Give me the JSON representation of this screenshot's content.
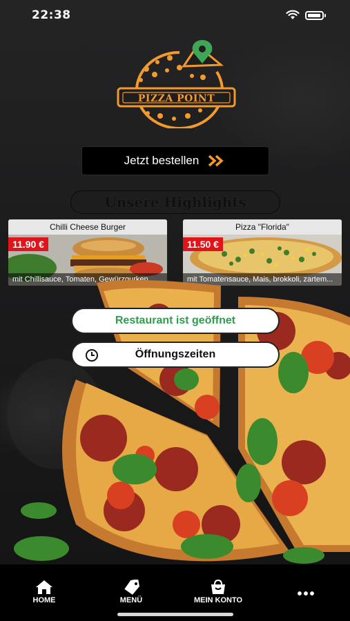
{
  "status_bar": {
    "time": "22:38",
    "icons": [
      "wifi-icon",
      "battery-icon"
    ]
  },
  "logo": {
    "text": "PIZZA POINT",
    "icon": "pizza-location-pin-icon"
  },
  "order_button": {
    "label": "Jetzt bestellen",
    "icon": "double-chevron-right-icon"
  },
  "highlights_title": "Unsere Highlights",
  "highlights": [
    {
      "name": "Chilli Cheese Burger",
      "price": "11.90 €",
      "description": "mit Chillisauce, Tomaten, Gewürzgurken"
    },
    {
      "name": "Pizza \"Florida\"",
      "price": "11.50 €",
      "description": "mit Tomatensauce, Mais, brokkoli, zartem..."
    }
  ],
  "status_pill": {
    "label": "Restaurant ist geöffnet"
  },
  "hours_pill": {
    "label": "Öffnungszeiten",
    "icon": "clock-icon"
  },
  "tabbar": {
    "items": [
      {
        "label": "HOME",
        "icon": "home-icon"
      },
      {
        "label": "MENÜ",
        "icon": "tag-icon"
      },
      {
        "label": "MEIN KONTO",
        "icon": "shopping-bag-icon"
      },
      {
        "label": "•••",
        "icon": "more-icon"
      }
    ]
  },
  "colors": {
    "accent": "#f29a2e",
    "open_green": "#2f9e4c",
    "price_red": "#e0141b"
  }
}
